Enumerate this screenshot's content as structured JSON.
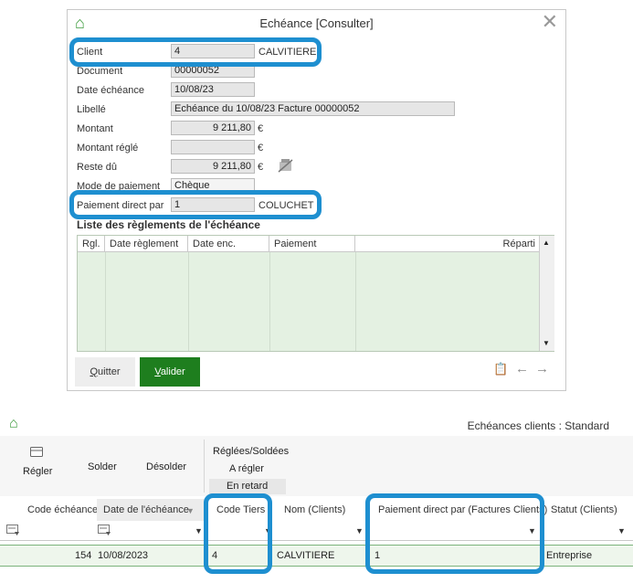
{
  "dialog": {
    "title": "Echéance [Consulter]",
    "close": "✕",
    "home": "⌂",
    "client": {
      "label": "Client",
      "code": "4",
      "name": "CALVITIERE"
    },
    "document": {
      "label": "Document",
      "value": "00000052"
    },
    "date_echeance": {
      "label": "Date échéance",
      "value": "10/08/23"
    },
    "libelle": {
      "label": "Libellé",
      "value": "Echéance du 10/08/23 Facture 00000052"
    },
    "montant": {
      "label": "Montant",
      "value": "9 211,80",
      "unit": "€"
    },
    "montant_regle": {
      "label": "Montant réglé",
      "value": "",
      "unit": "€"
    },
    "reste_du": {
      "label": "Reste dû",
      "value": "9 211,80",
      "unit": "€"
    },
    "mode_paiement": {
      "label": "Mode de paiement",
      "value": "Chèque"
    },
    "paiement_direct": {
      "label": "Paiement direct par",
      "code": "1",
      "name": "COLUCHET"
    },
    "reglements_title": "Liste des règlements de l'échéance",
    "grid_headers": [
      "Rgl.",
      "Date règlement",
      "Date enc.",
      "Paiement",
      "Réparti"
    ],
    "btn_quitter": "Quitter",
    "btn_valider": "Valider",
    "nav": {
      "clipboard": "📋",
      "prev": "←",
      "next": "→"
    }
  },
  "list": {
    "home": "⌂",
    "title": "Echéances clients : Standard",
    "toolbar": {
      "regler": "Régler",
      "solder": "Solder",
      "desolder": "Désolder",
      "filters": [
        "Réglées/Soldées",
        "A régler",
        "En retard"
      ]
    },
    "columns": [
      "Code échéance",
      "Date de l'échéance",
      "Code Tiers",
      "Nom (Clients)",
      "Paiement direct par (Factures Clients)",
      "Statut (Clients)"
    ],
    "row": {
      "code_echeance": "154",
      "date": "10/08/2023",
      "code_tiers": "4",
      "nom": "CALVITIERE",
      "paiement_direct": "1",
      "statut": "Entreprise"
    }
  },
  "colors": {
    "highlight": "#1e8fd0",
    "valider": "#1e7e1e",
    "grid": "#e4f1e2"
  }
}
